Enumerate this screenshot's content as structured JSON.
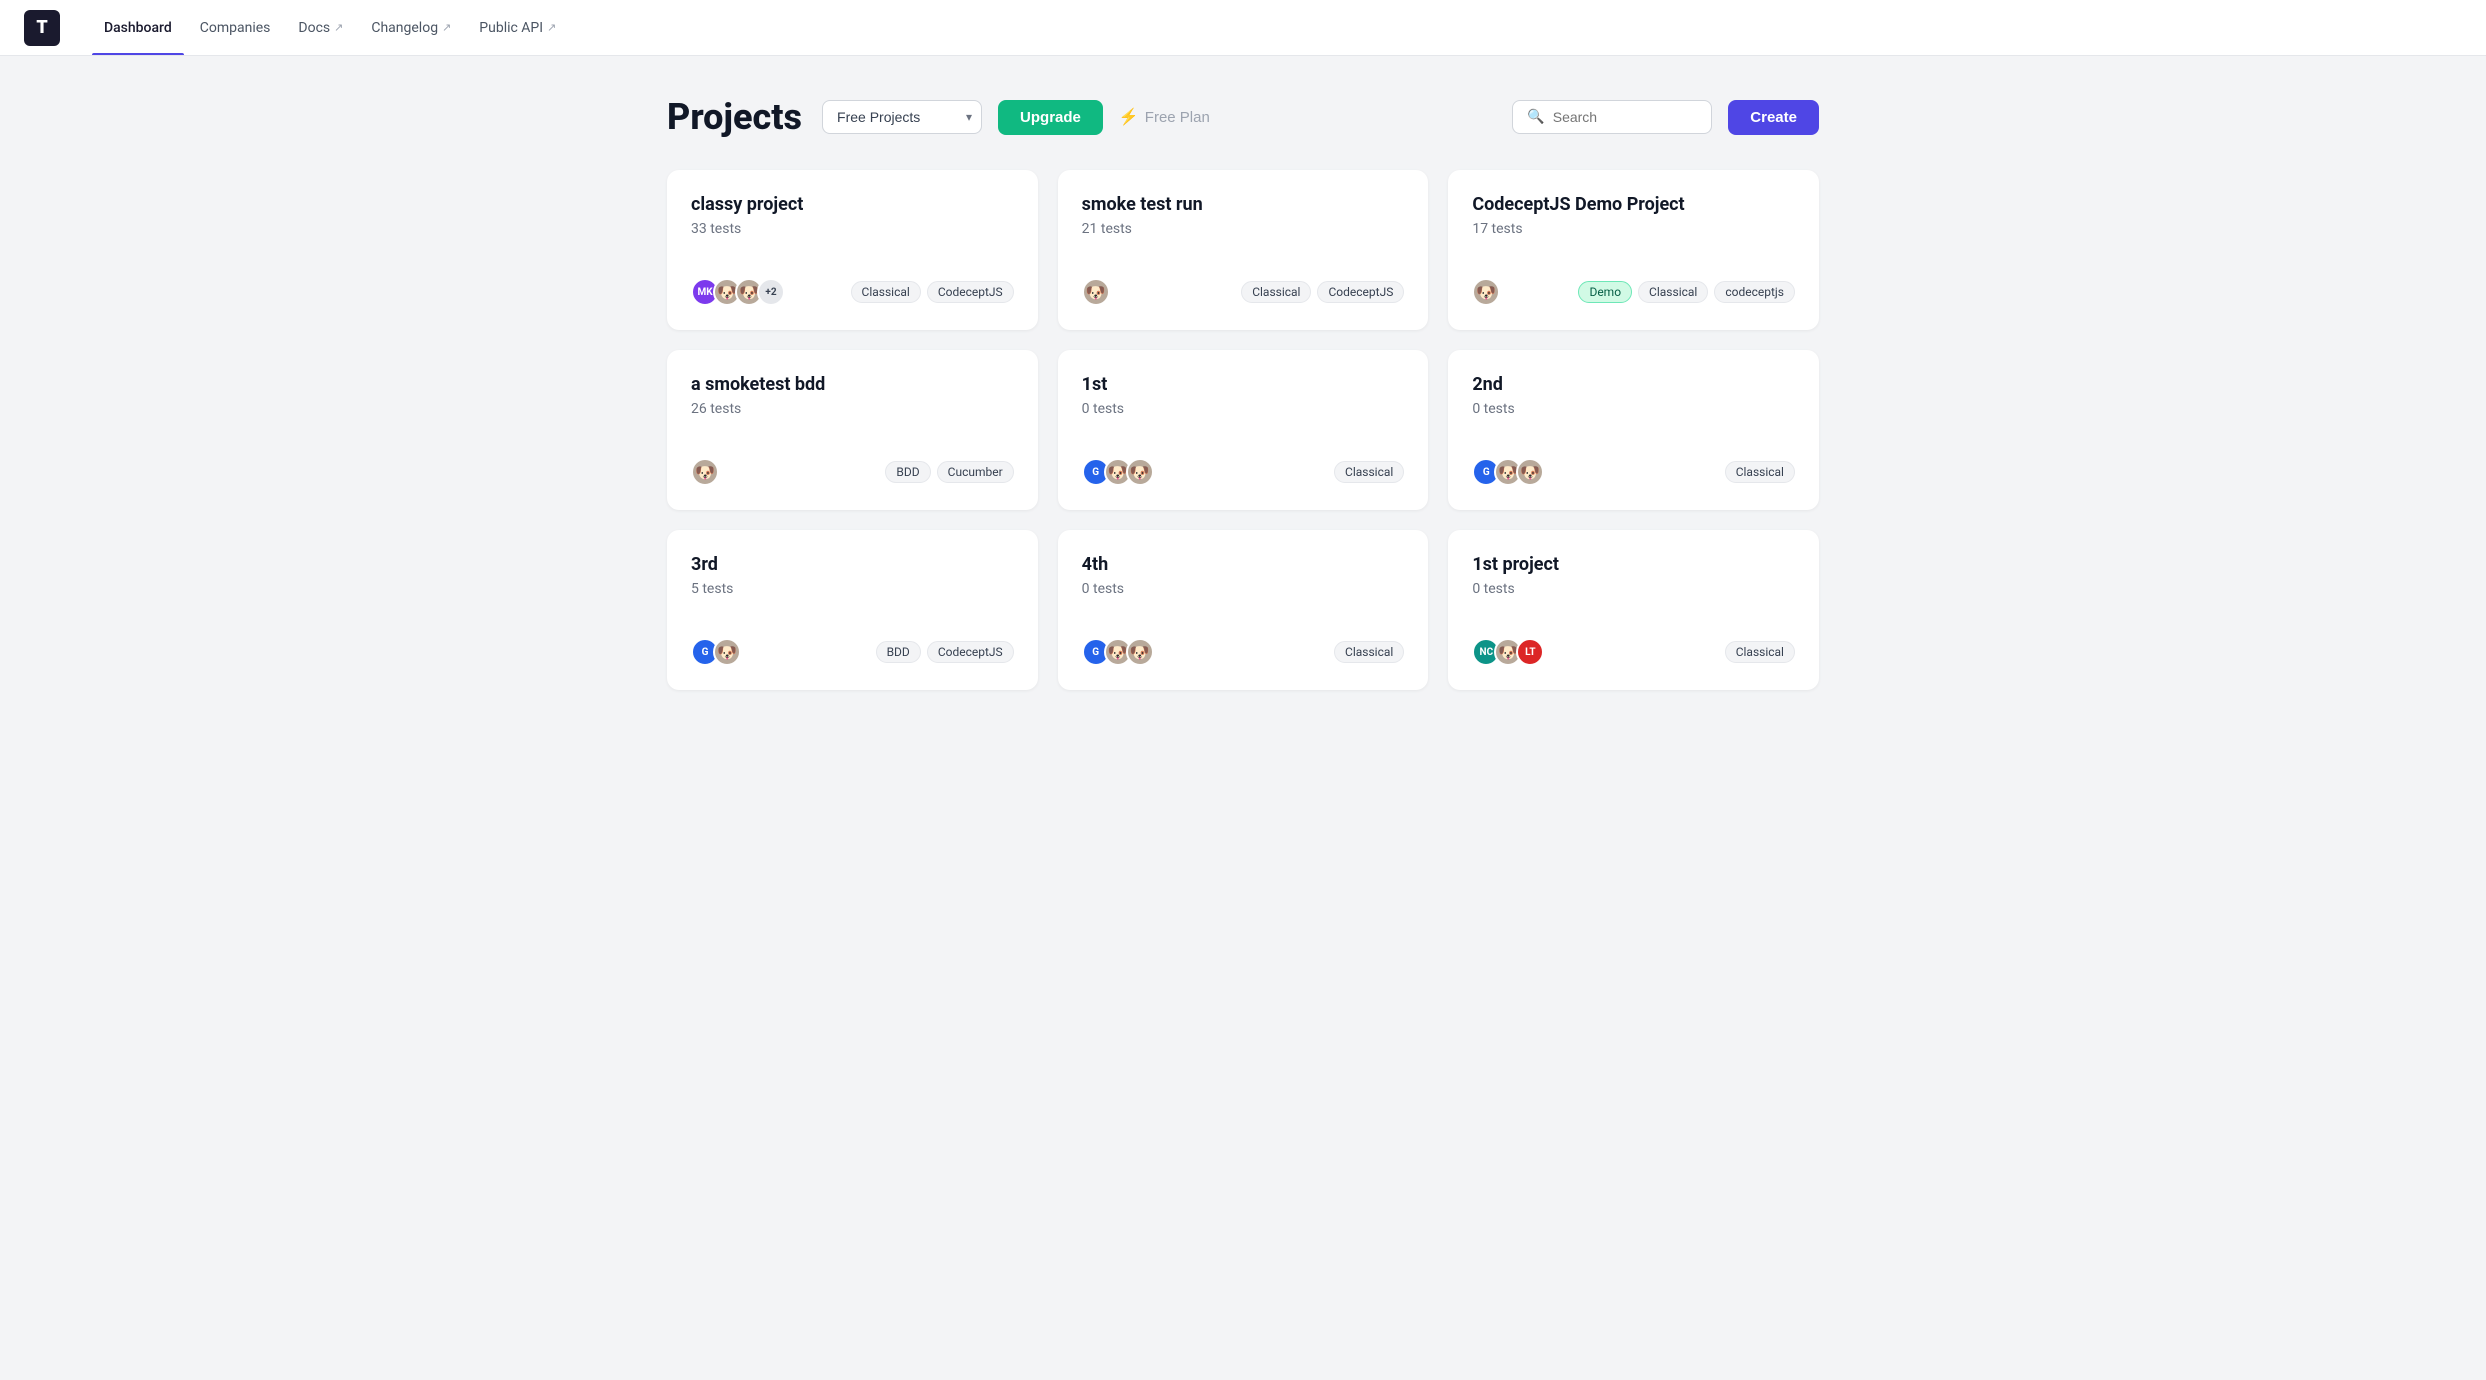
{
  "nav": {
    "logo": "T",
    "items": [
      {
        "id": "dashboard",
        "label": "Dashboard",
        "active": true,
        "external": false
      },
      {
        "id": "companies",
        "label": "Companies",
        "active": false,
        "external": false
      },
      {
        "id": "docs",
        "label": "Docs",
        "active": false,
        "external": true
      },
      {
        "id": "changelog",
        "label": "Changelog",
        "active": false,
        "external": true
      },
      {
        "id": "public-api",
        "label": "Public API",
        "active": false,
        "external": true
      }
    ]
  },
  "page": {
    "title": "Projects",
    "dropdown_value": "Free Projects",
    "upgrade_label": "Upgrade",
    "free_plan_label": "Free Plan",
    "search_placeholder": "Search",
    "create_label": "Create"
  },
  "projects": [
    {
      "id": "classy-project",
      "name": "classy project",
      "tests": "33 tests",
      "avatars": [
        {
          "initials": "MK",
          "color": "av-purple"
        },
        {
          "initials": "🐶",
          "color": "av-gray"
        },
        {
          "initials": "🐶",
          "color": "av-gray"
        },
        {
          "initials": "+2",
          "color": "avatar-count"
        }
      ],
      "tags": [
        "Classical",
        "CodeceptJS"
      ]
    },
    {
      "id": "smoke-test-run",
      "name": "smoke test run",
      "tests": "21 tests",
      "avatars": [
        {
          "initials": "🐶",
          "color": "av-gray"
        }
      ],
      "tags": [
        "Classical",
        "CodeceptJS"
      ]
    },
    {
      "id": "codeceptjs-demo",
      "name": "CodeceptJS Demo Project",
      "tests": "17 tests",
      "avatars": [
        {
          "initials": "🐶",
          "color": "av-gray"
        }
      ],
      "tags": [
        "Demo",
        "Classical",
        "codeceptjs"
      ],
      "demo_tag": true
    },
    {
      "id": "smoketest-bdd",
      "name": "a smoketest bdd",
      "tests": "26 tests",
      "avatars": [
        {
          "initials": "🐶",
          "color": "av-gray"
        }
      ],
      "tags": [
        "BDD",
        "Cucumber"
      ]
    },
    {
      "id": "1st",
      "name": "1st",
      "tests": "0 tests",
      "avatars": [
        {
          "initials": "G",
          "color": "av-blue"
        },
        {
          "initials": "🐶",
          "color": "av-gray"
        },
        {
          "initials": "🐶",
          "color": "av-gray"
        }
      ],
      "tags": [
        "Classical"
      ]
    },
    {
      "id": "2nd",
      "name": "2nd",
      "tests": "0 tests",
      "avatars": [
        {
          "initials": "G",
          "color": "av-blue"
        },
        {
          "initials": "🐶",
          "color": "av-gray"
        },
        {
          "initials": "🐶",
          "color": "av-gray"
        }
      ],
      "tags": [
        "Classical"
      ]
    },
    {
      "id": "3rd",
      "name": "3rd",
      "tests": "5 tests",
      "avatars": [
        {
          "initials": "G",
          "color": "av-blue"
        },
        {
          "initials": "🐶",
          "color": "av-gray"
        }
      ],
      "tags": [
        "BDD",
        "CodeceptJS"
      ]
    },
    {
      "id": "4th",
      "name": "4th",
      "tests": "0 tests",
      "avatars": [
        {
          "initials": "G",
          "color": "av-blue"
        },
        {
          "initials": "🐶",
          "color": "av-gray"
        },
        {
          "initials": "🐶",
          "color": "av-gray"
        }
      ],
      "tags": [
        "Classical"
      ]
    },
    {
      "id": "1st-project",
      "name": "1st project",
      "tests": "0 tests",
      "avatars": [
        {
          "initials": "NC",
          "color": "av-teal"
        },
        {
          "initials": "🐶",
          "color": "av-gray"
        },
        {
          "initials": "LT",
          "color": "av-red"
        }
      ],
      "tags": [
        "Classical"
      ]
    }
  ]
}
